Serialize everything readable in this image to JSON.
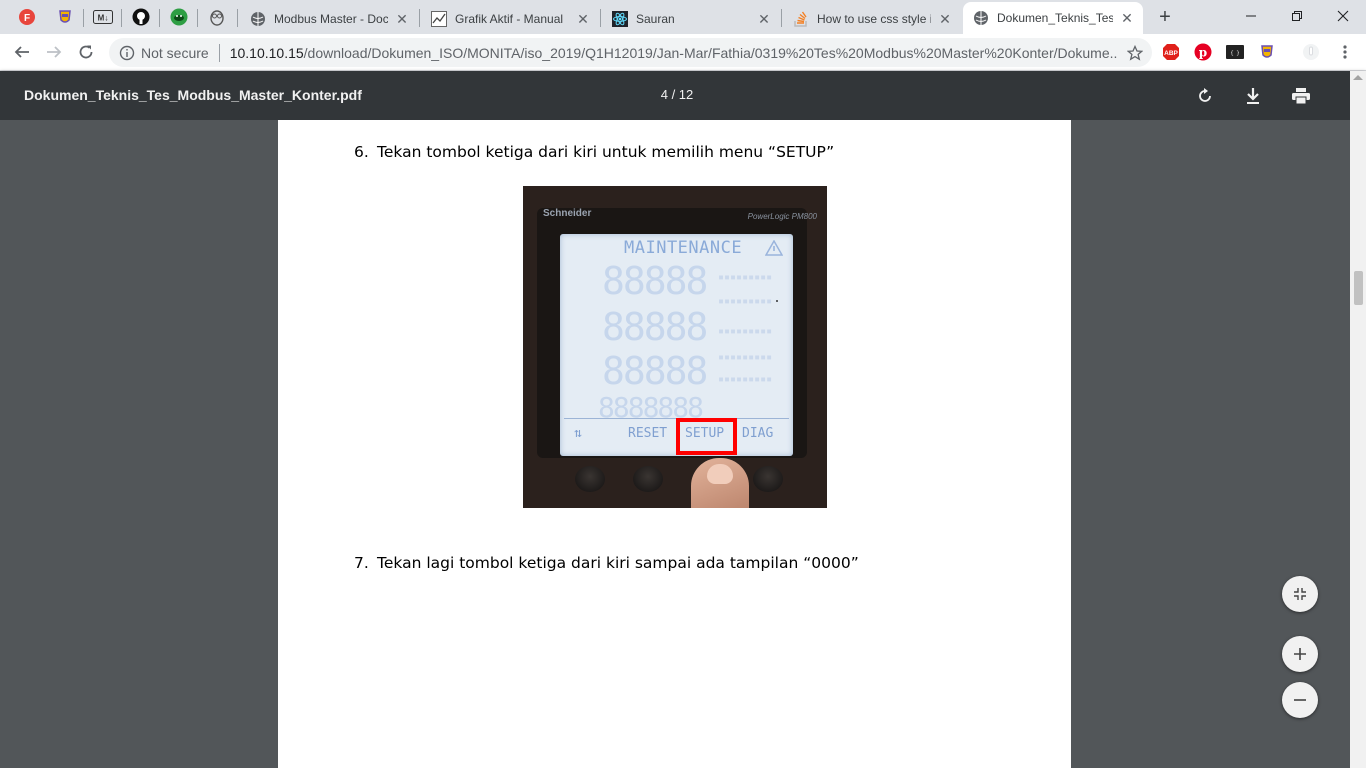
{
  "browser": {
    "pinned_tabs": [
      "profile-icon",
      "extension-icon",
      "markdown-icon",
      "github-icon",
      "cloud-icon",
      "owl-icon"
    ],
    "tabs": [
      {
        "title": "Modbus Master - Doc",
        "icon": "globe-icon"
      },
      {
        "title": "Grafik Aktif - Manual",
        "icon": "chart-icon"
      },
      {
        "title": "Sauran",
        "icon": "react-icon"
      },
      {
        "title": "How to use css style in",
        "icon": "stackoverflow-icon"
      },
      {
        "title": "Dokumen_Teknis_Tes_",
        "icon": "globe-icon",
        "active": true
      }
    ],
    "new_tab_label": "+",
    "address": {
      "security": "Not secure",
      "host": "10.10.10.15",
      "path": "/download/Dokumen_ISO/MONITA/iso_2019/Q1H12019/Jan-Mar/Fathia/0319%20Tes%20Modbus%20Master%20Konter/Dokume..."
    },
    "extensions": [
      "adblock-icon",
      "pinterest-icon",
      "json-icon",
      "extension-icon",
      "profile-icon",
      "menu-icon"
    ]
  },
  "pdf": {
    "file_name": "Dokumen_Teknis_Tes_Modbus_Master_Konter.pdf",
    "page_indicator": "4 / 12",
    "actions": [
      "rotate-icon",
      "download-icon",
      "print-icon"
    ],
    "steps": [
      {
        "number": "6.",
        "text": "Tekan tombol ketiga dari kiri untuk memilih menu “SETUP”"
      },
      {
        "number": "7.",
        "text": "Tekan lagi tombol ketiga dari kiri sampai ada tampilan “0000”"
      }
    ],
    "photo": {
      "brand": "Schneider",
      "model": "PowerLogic PM800",
      "screen_title": "MAINTENANCE",
      "menu_items": [
        "⇅",
        "RESET",
        "SETUP",
        "DIAG"
      ],
      "highlight_color": "#ff0000"
    },
    "zoom_controls": [
      "fit-icon",
      "zoom-in-icon",
      "zoom-out-icon"
    ]
  },
  "colors": {
    "pdf_toolbar": "#323639",
    "viewer_bg": "#525659",
    "highlight": "#ff0000"
  }
}
